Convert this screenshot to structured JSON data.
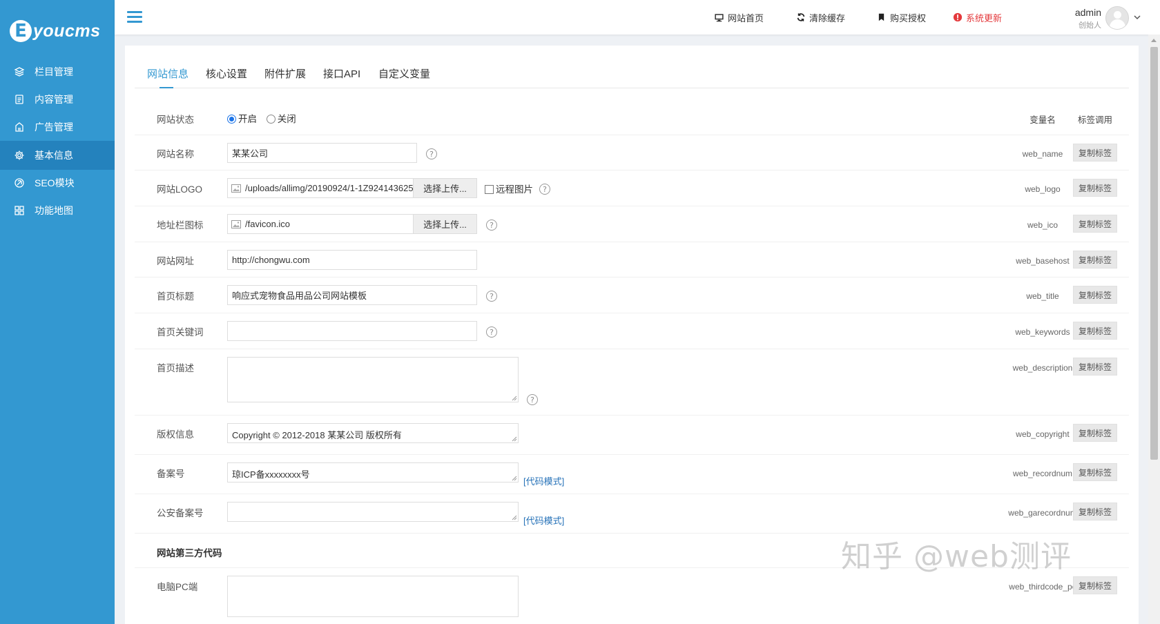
{
  "sidebar": {
    "logo": {
      "mark": "E",
      "text": "youcms"
    },
    "items": [
      {
        "label": "栏目管理",
        "icon": "layers-icon"
      },
      {
        "label": "内容管理",
        "icon": "document-icon"
      },
      {
        "label": "广告管理",
        "icon": "ad-icon"
      },
      {
        "label": "基本信息",
        "icon": "gear-icon",
        "active": true
      },
      {
        "label": "SEO模块",
        "icon": "seo-icon"
      },
      {
        "label": "功能地图",
        "icon": "grid-icon"
      }
    ]
  },
  "header": {
    "links": [
      {
        "label": "网站首页",
        "icon": "monitor-icon"
      },
      {
        "label": "清除缓存",
        "icon": "refresh-icon"
      },
      {
        "label": "购买授权",
        "icon": "bookmark-icon"
      },
      {
        "label": "系统更新",
        "icon": "alert-icon"
      }
    ],
    "user": {
      "name": "admin",
      "role": "创始人"
    }
  },
  "tabs": [
    "网站信息",
    "核心设置",
    "附件扩展",
    "接口API",
    "自定义变量"
  ],
  "table_headers": {
    "var_name": "变量名",
    "tag_call": "标签调用"
  },
  "copy_label": "复制标签",
  "code_mode_label": "[代码模式]",
  "rows": {
    "status": {
      "label": "网站状态",
      "on": "开启",
      "off": "关闭",
      "selected": "开启"
    },
    "name": {
      "label": "网站名称",
      "value": "某某公司",
      "var": "web_name"
    },
    "logo": {
      "label": "网站LOGO",
      "value": "/uploads/allimg/20190924/1-1Z924143625",
      "button": "选择上传...",
      "remote": "远程图片",
      "var": "web_logo"
    },
    "ico": {
      "label": "地址栏图标",
      "value": "/favicon.ico",
      "button": "选择上传...",
      "var": "web_ico"
    },
    "basehost": {
      "label": "网站网址",
      "value": "http://chongwu.com",
      "var": "web_basehost"
    },
    "title": {
      "label": "首页标题",
      "value": "响应式宠物食品用品公司网站模板",
      "var": "web_title"
    },
    "keywords": {
      "label": "首页关键词",
      "value": "",
      "var": "web_keywords"
    },
    "description": {
      "label": "首页描述",
      "value": "",
      "var": "web_description"
    },
    "copyright": {
      "label": "版权信息",
      "value": "Copyright © 2012-2018 某某公司 版权所有",
      "var": "web_copyright"
    },
    "recordnum": {
      "label": "备案号",
      "value": "琼ICP备xxxxxxxx号",
      "var": "web_recordnum"
    },
    "garecordnum": {
      "label": "公安备案号",
      "value": "",
      "var": "web_garecordnum"
    },
    "thirdcode_section": {
      "label": "网站第三方代码"
    },
    "thirdcode_pc": {
      "label": "电脑PC端",
      "value": "",
      "var": "web_thirdcode_pc"
    }
  },
  "watermark": "知乎 @web测评",
  "colors": {
    "sidebar": "#3398d1",
    "sidebar_active": "#2482bd",
    "accent": "#3398d1",
    "alert": "#e4393c",
    "link": "#2672b8"
  }
}
